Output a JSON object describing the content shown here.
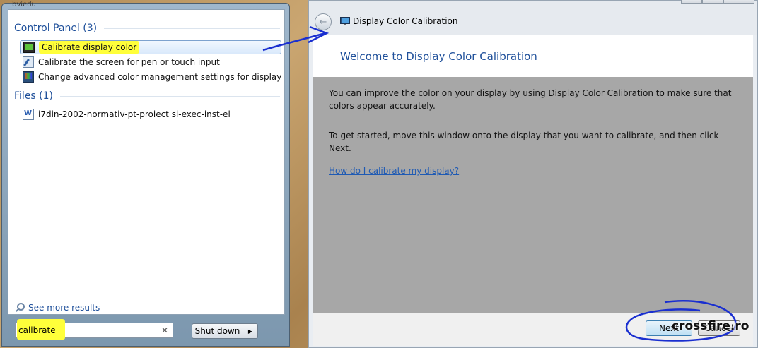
{
  "start_menu": {
    "top_strip": "bviedu",
    "groups": [
      {
        "title": "Control Panel (3)"
      },
      {
        "title": "Files (1)"
      }
    ],
    "results": [
      {
        "label": "Calibrate display color",
        "icon": "display-calibration-icon"
      },
      {
        "label": "Calibrate the screen for pen or touch input",
        "icon": "pen-input-icon"
      },
      {
        "label": "Change advanced color management settings for displays, sca...",
        "icon": "color-management-icon"
      },
      {
        "label": "i7din-2002-normativ-pt-proiect si-exec-inst-el",
        "icon": "word-document-icon"
      }
    ],
    "see_more": "See more results",
    "search": {
      "value": "calibrate",
      "clear": "✕"
    },
    "shutdown_label": "Shut down",
    "shutdown_arrow": "▶"
  },
  "calibration_window": {
    "title": "Display Color Calibration",
    "back_glyph": "←",
    "heading": "Welcome to Display Color Calibration",
    "para1": "You can improve the color on your display by using Display Color Calibration to make sure that colors appear accurately.",
    "para2": "To get started, move this window onto the display that you want to calibrate, and then click Next.",
    "help_link": "How do I calibrate my display?",
    "next_label": "Next",
    "cancel_label": "Cancel"
  },
  "watermark": "crossfire.ro",
  "colors": {
    "highlight": "#ffff3a",
    "accent": "#1e4f9a",
    "annotation": "#1a2fd0"
  }
}
